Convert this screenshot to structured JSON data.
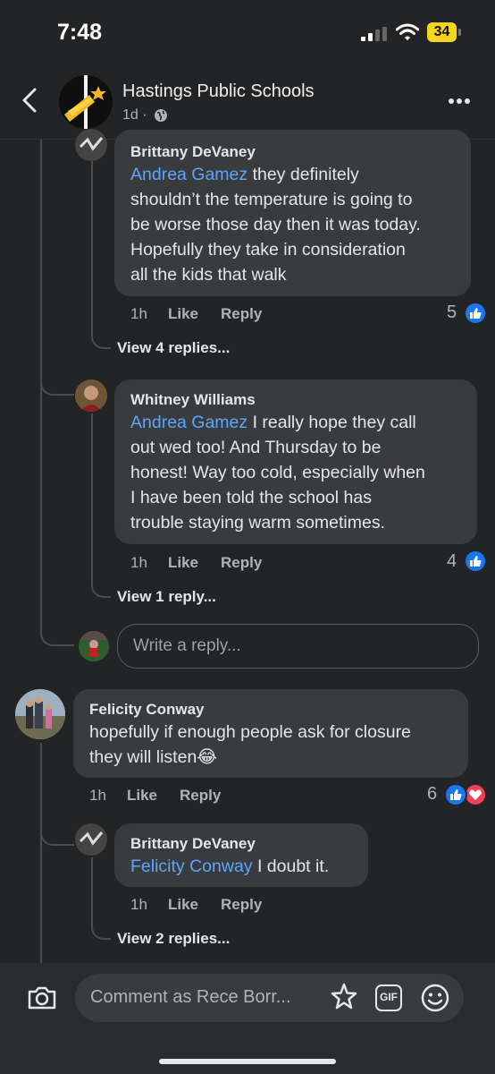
{
  "status_bar": {
    "time": "7:48",
    "battery_level": "34"
  },
  "header": {
    "page_name": "Hastings Public Schools",
    "post_time": "1d ·"
  },
  "comments": [
    {
      "author": "Brittany DeVaney",
      "mention": "Andrea Gamez",
      "text": " they definitely\nshouldn’t the temperature is going to\nbe worse those day then it was today.\nHopefully they take in consideration\nall the kids that walk",
      "time": "1h",
      "like_label": "Like",
      "reply_label": "Reply",
      "reaction_count": "5",
      "reactions": [
        "like"
      ],
      "view_replies": "View 4 replies..."
    },
    {
      "author": "Whitney Williams",
      "mention": "Andrea Gamez",
      "text": " I really hope they call\nout wed too! And Thursday to be\nhonest! Way too cold, especially when\nI have been told the school has\ntrouble staying warm sometimes.",
      "time": "1h",
      "like_label": "Like",
      "reply_label": "Reply",
      "reaction_count": "4",
      "reactions": [
        "like"
      ],
      "view_replies": "View 1 reply..."
    },
    {
      "author": "Felicity Conway",
      "text": "hopefully if enough people ask for closure\nthey will listen😂",
      "time": "1h",
      "like_label": "Like",
      "reply_label": "Reply",
      "reaction_count": "6",
      "reactions": [
        "like",
        "love"
      ]
    },
    {
      "author": "Brittany DeVaney",
      "mention": "Felicity Conway",
      "text": " I doubt it.",
      "time": "1h",
      "like_label": "Like",
      "reply_label": "Reply",
      "view_replies": "View 2 replies..."
    }
  ],
  "reply_input": {
    "placeholder": "Write a reply..."
  },
  "comment_bar": {
    "placeholder": "Comment as Rece Borr...",
    "gif_label": "GIF"
  },
  "colors": {
    "background": "#232425",
    "bubble": "#3a3b3c",
    "mention": "#5aa7ff",
    "like": "#1877f2",
    "love": "#f33e58"
  },
  "icons": [
    "back-arrow-icon",
    "globe-icon",
    "more-icon",
    "like-icon",
    "love-icon",
    "camera-icon",
    "avatar-sticker-icon",
    "gif-icon",
    "emoji-icon"
  ]
}
